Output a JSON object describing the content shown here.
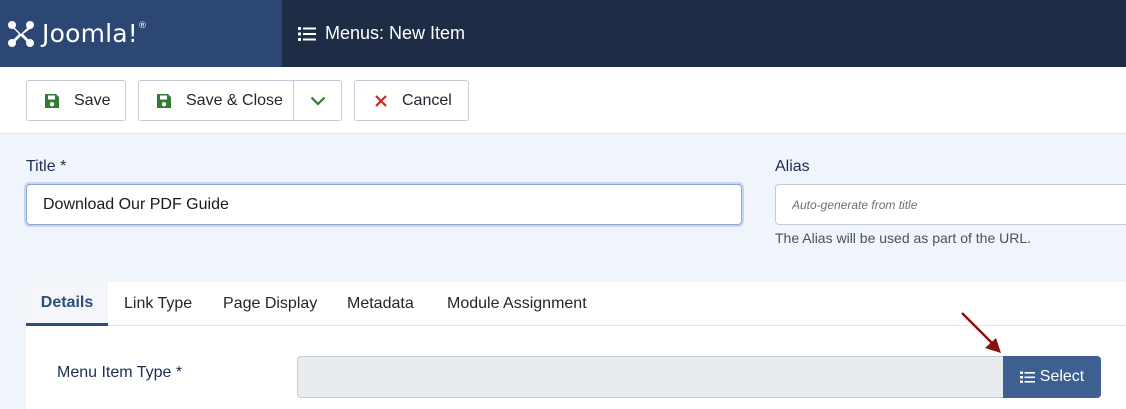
{
  "header": {
    "logo_text": "Joomla!",
    "page_title": "Menus: New Item"
  },
  "toolbar": {
    "save_label": "Save",
    "save_close_label": "Save & Close",
    "cancel_label": "Cancel"
  },
  "form": {
    "title_label": "Title *",
    "title_value": "Download Our PDF Guide",
    "alias_label": "Alias",
    "alias_placeholder": "Auto-generate from title",
    "alias_help": "The Alias will be used as part of the URL."
  },
  "tabs": [
    {
      "label": "Details",
      "active": true
    },
    {
      "label": "Link Type",
      "active": false
    },
    {
      "label": "Page Display",
      "active": false
    },
    {
      "label": "Metadata",
      "active": false
    },
    {
      "label": "Module Assignment",
      "active": false
    }
  ],
  "details": {
    "menu_item_type_label": "Menu Item Type *",
    "select_label": "Select"
  },
  "colors": {
    "header_bg": "#1f2c45",
    "logo_bg": "#2c4774",
    "save_icon": "#2e7d32",
    "cancel_icon": "#c62828",
    "select_btn": "#3d5f92",
    "annotation_arrow": "#8b1111"
  },
  "icons": {
    "save": "floppy-disk-icon",
    "cancel": "close-icon",
    "dropdown": "chevron-down-icon",
    "list": "list-icon"
  }
}
